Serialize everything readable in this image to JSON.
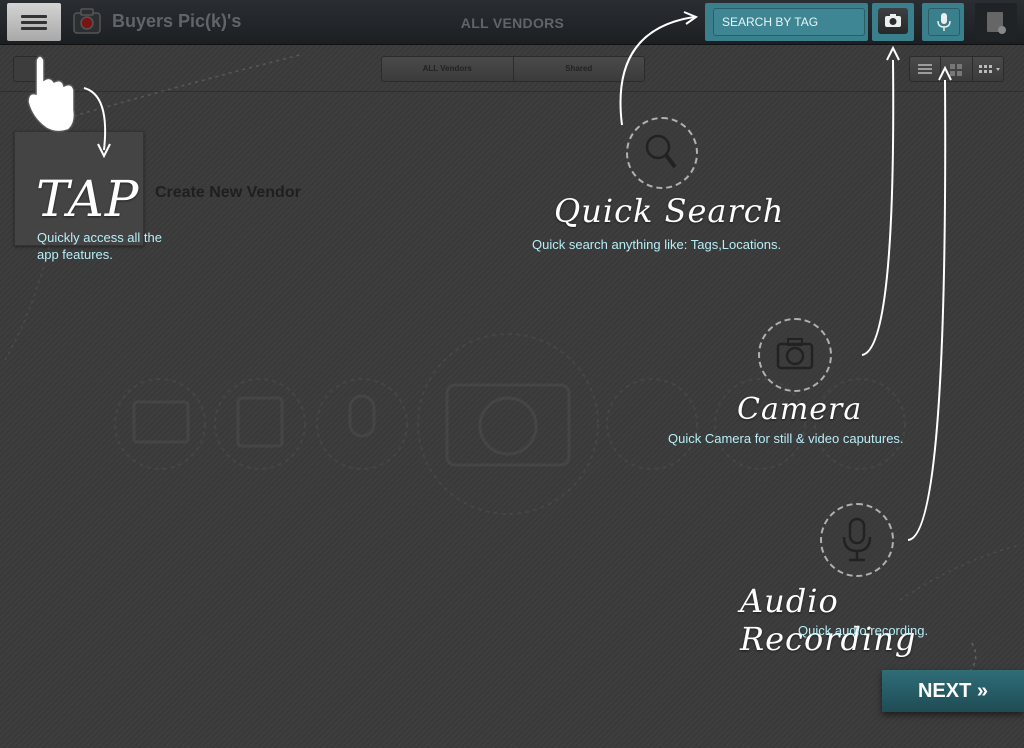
{
  "topbar": {
    "app_title": "Buyers Pic(k)'s",
    "center_title": "ALL VENDORS",
    "search_placeholder": "SEARCH BY TAG"
  },
  "toolbar": {
    "segments": [
      "ALL Vendors",
      "Shared"
    ]
  },
  "vendor": {
    "create_label": "Create New Vendor"
  },
  "tutorial": {
    "tap": {
      "title": "TAP",
      "desc_line1": "Quickly access all the",
      "desc_line2": "app features."
    },
    "quick_search": {
      "title": "Quick Search",
      "desc": "Quick search anything like: Tags,Locations."
    },
    "camera": {
      "title": "Camera",
      "desc": "Quick Camera for still & video caputures."
    },
    "audio": {
      "title": "Audio Recording",
      "desc": "Quick audio recording."
    },
    "next_label": "NEXT »"
  },
  "icons": [
    "menu-icon",
    "camera-logo-icon",
    "camera-icon",
    "microphone-icon",
    "note-icon",
    "list-view-icon",
    "grid-view-icon",
    "magnifier-icon",
    "hand-pointer-icon"
  ],
  "colors": {
    "accent": "#3a7f8c",
    "hint_text": "#b7eef7"
  }
}
